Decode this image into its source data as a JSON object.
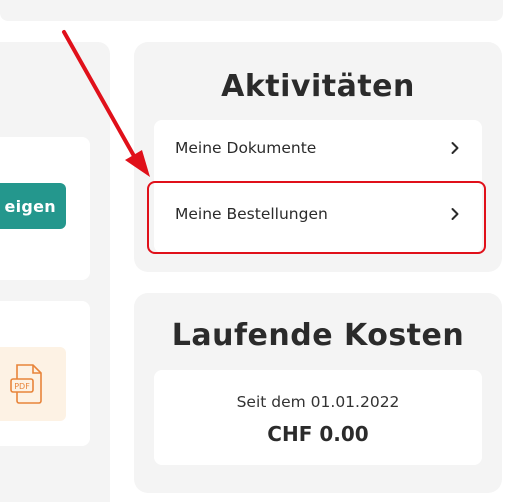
{
  "left_panel": {
    "button_label_partial": "eigen",
    "pdf_icon_label": "PDF"
  },
  "activities": {
    "title": "Aktivitäten",
    "items": [
      {
        "label": "Meine Dokumente",
        "icon": "chevron-right-icon"
      },
      {
        "label": "Meine Bestellungen",
        "icon": "chevron-right-icon"
      }
    ],
    "highlighted_item": "Meine Bestellungen",
    "highlight_color": "#e0101a"
  },
  "costs": {
    "title": "Laufende Kosten",
    "since": "Seit dem 01.01.2022",
    "amount": "CHF 0.00"
  },
  "colors": {
    "accent": "#24978d",
    "card_bg": "#f4f4f4",
    "annotation": "#e0101a",
    "pdf_tile": "#fdf2e4",
    "pdf_icon": "#e8843a"
  }
}
